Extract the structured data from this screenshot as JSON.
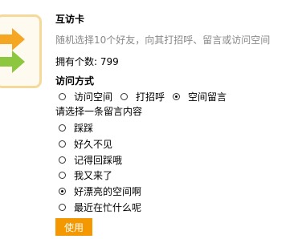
{
  "card": {
    "title": "互访卡",
    "description": "随机选择10个好友，向其打招呼、留言或访问空间",
    "count_label": "拥有个数: 799"
  },
  "visit_mode": {
    "title": "访问方式",
    "options": [
      {
        "label": "访问空间",
        "checked": false
      },
      {
        "label": "打招呼",
        "checked": false
      },
      {
        "label": "空间留言",
        "checked": true
      }
    ]
  },
  "messages": {
    "prompt": "请选择一条留言内容",
    "options": [
      {
        "label": "踩踩",
        "checked": false
      },
      {
        "label": "好久不见",
        "checked": false
      },
      {
        "label": "记得回踩哦",
        "checked": false
      },
      {
        "label": "我又来了",
        "checked": false
      },
      {
        "label": "好漂亮的空间啊",
        "checked": true
      },
      {
        "label": "最近在忙什么呢",
        "checked": false
      }
    ]
  },
  "actions": {
    "use_label": "使用"
  },
  "colors": {
    "accent": "#f39800",
    "card_border": "#f4d99a",
    "arrow_orange": "#f5a623",
    "arrow_green": "#8dc63f",
    "muted_text": "#888888"
  }
}
